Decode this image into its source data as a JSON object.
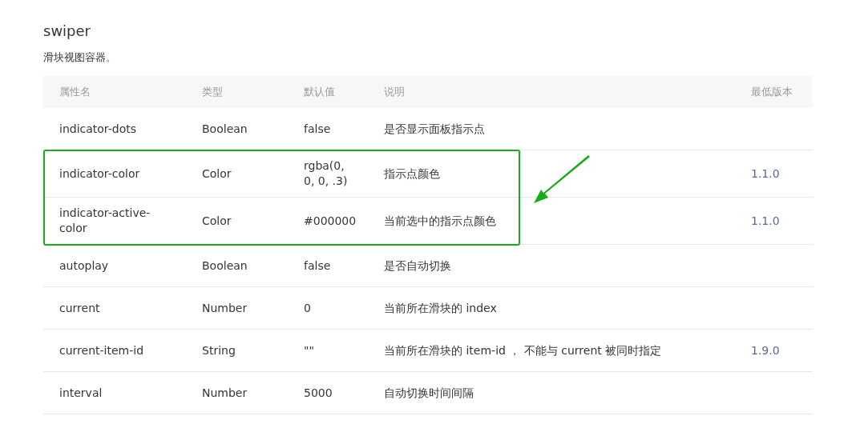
{
  "title": "swiper",
  "description": "滑块视图容器。",
  "table": {
    "columns": [
      "属性名",
      "类型",
      "默认值",
      "说明",
      "最低版本"
    ],
    "rows": [
      {
        "name": "indicator-dots",
        "type": "Boolean",
        "default": "false",
        "description": "是否显示面板指示点",
        "highlighted": false
      },
      {
        "name": "indicator-color",
        "type": "Color",
        "default": "rgba(0, 0, 0, .3)",
        "description": "指示点颜色",
        "version": "1.1.0",
        "highlighted": true
      },
      {
        "name": "indicator-active-color",
        "type": "Color",
        "default": "#000000",
        "description": "当前选中的指示点颜色",
        "version": "1.1.0",
        "highlighted": true
      },
      {
        "name": "autoplay",
        "type": "Boolean",
        "default": "false",
        "description": "是否自动切换",
        "highlighted": false
      },
      {
        "name": "current",
        "type": "Number",
        "default": "0",
        "description": "当前所在滑块的 index",
        "highlighted": false
      },
      {
        "name": "current-item-id",
        "type": "String",
        "default": "\"\"",
        "description": "当前所在滑块的 item-id ， 不能与 current 被同时指定",
        "version": "1.9.0",
        "highlighted": false
      },
      {
        "name": "interval",
        "type": "Number",
        "default": "5000",
        "description": "自动切换时间间隔",
        "highlighted": false
      }
    ]
  }
}
